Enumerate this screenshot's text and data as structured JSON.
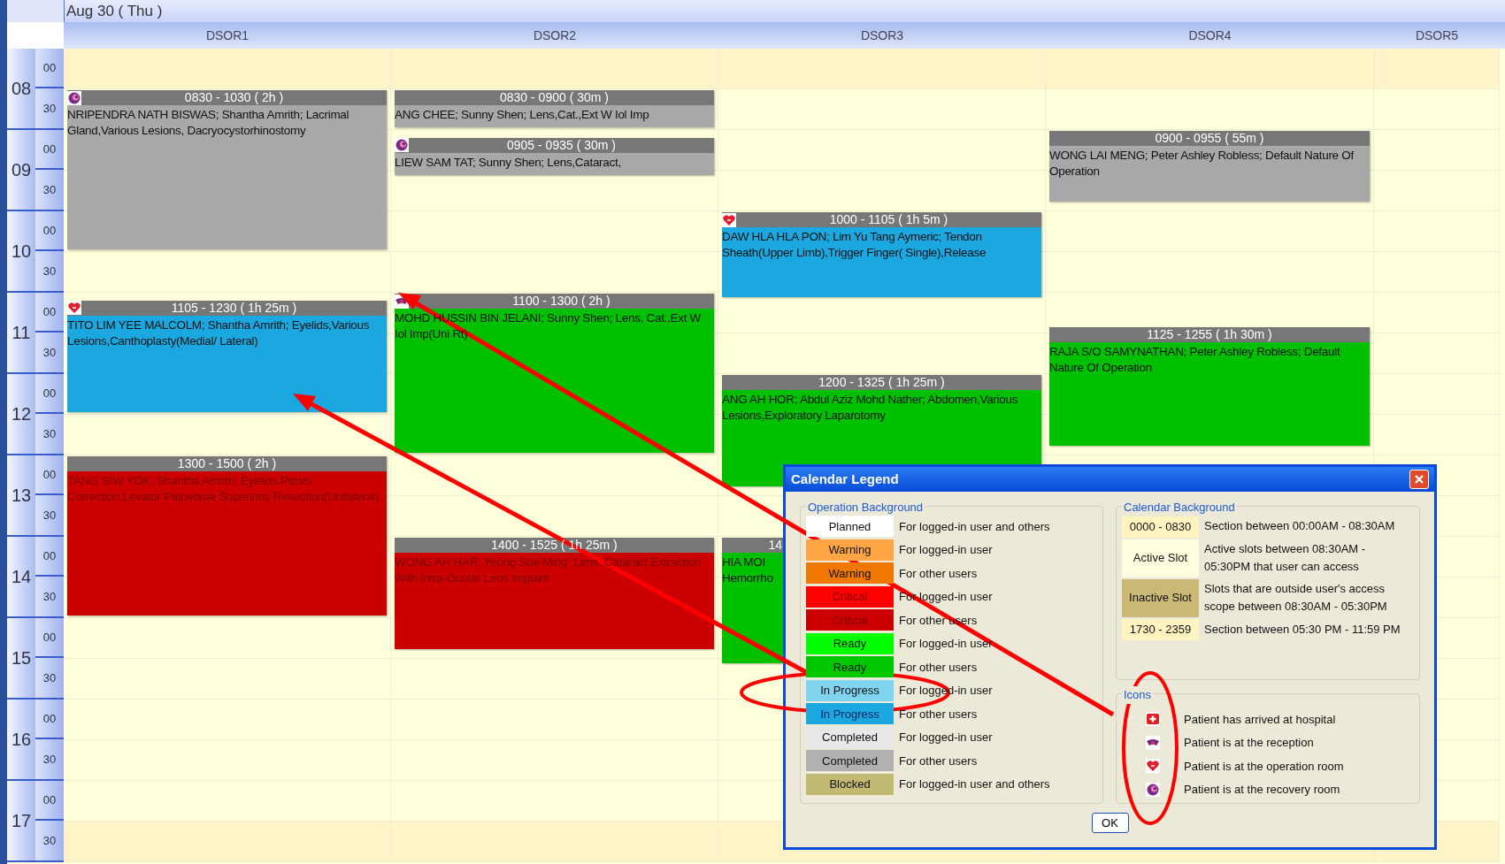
{
  "date_header": "Aug 30 ( Thu )",
  "time_axis": [
    {
      "hour": "08",
      "minutes": [
        "00",
        "30"
      ]
    },
    {
      "hour": "09",
      "minutes": [
        "00",
        "30"
      ]
    },
    {
      "hour": "10",
      "minutes": [
        "00",
        "30"
      ]
    },
    {
      "hour": "11",
      "minutes": [
        "00",
        "30"
      ]
    },
    {
      "hour": "12",
      "minutes": [
        "00",
        "30"
      ]
    },
    {
      "hour": "13",
      "minutes": [
        "00",
        "30"
      ]
    },
    {
      "hour": "14",
      "minutes": [
        "00",
        "30"
      ]
    },
    {
      "hour": "15",
      "minutes": [
        "00",
        "30"
      ]
    },
    {
      "hour": "16",
      "minutes": [
        "00",
        "30"
      ]
    },
    {
      "hour": "17",
      "minutes": [
        "00",
        "30"
      ]
    }
  ],
  "rooms": [
    {
      "name": "DSOR1",
      "events": [
        {
          "time": "0830 - 1030 ( 2h )",
          "text": "NRIPENDRA NATH BISWAS; Shantha Amrith; Lacrimal Gland,Various Lesions, Dacryocystorhinostomy",
          "kind": "completed",
          "patient_icon": {
            "kind": "recovery"
          }
        },
        {
          "time": "1105 - 1230 ( 1h 25m )",
          "text": "TITO LIM YEE MALCOLM; Shantha Amrith; Eyelids,Various Lesions,Canthoplasty(Medial/ Lateral)",
          "kind": "in_progress",
          "patient_icon": {
            "kind": "operation"
          }
        },
        {
          "time": "1300 - 1500 ( 2h )",
          "text": "TANG SIW YOK; Shantha Amrith; Eyelids,Ptosis Correction,Levator Palpebrae Superioris Resection(Unilateral)",
          "kind": "critical"
        }
      ]
    },
    {
      "name": "DSOR2",
      "events": [
        {
          "time": "0830 - 0900 ( 30m )",
          "text": "ANG CHEE; Sunny Shen; Lens,Cat.,Ext W Iol Imp",
          "kind": "completed"
        },
        {
          "time": "0905 - 0935 ( 30m )",
          "text": "LIEW SAM TAT; Sunny Shen; Lens,Cataract,",
          "kind": "completed",
          "patient_icon": {
            "kind": "recovery"
          }
        },
        {
          "time": "1100 - 1300 ( 2h )",
          "text": "MOHD HUSSIN BIN JELANI; Sunny Shen; Lens, Cat.,Ext W Iol Imp(Uni Rt)",
          "kind": "ready",
          "patient_icon": {
            "kind": "reception"
          }
        },
        {
          "time": "1400 - 1525 ( 1h 25m )",
          "text": "WONG AH HAR; Yeong Sue Ming; Lens, Cataract,Extraction With Intra-Ocular Lens Implant",
          "kind": "critical"
        }
      ]
    },
    {
      "name": "DSOR3",
      "events": [
        {
          "time": "1000 - 1105 ( 1h 5m )",
          "text": "DAW HLA HLA PON; Lim Yu Tang Aymeric; Tendon Sheath(Upper Limb),Trigger Finger( Single),Release",
          "kind": "in_progress",
          "patient_icon": {
            "kind": "operation"
          }
        },
        {
          "time": "1200 - 1325 ( 1h 25m )",
          "text": "ANG AH HOR; Abdul Aziz Mohd Nather; Abdomen,Various Lesions,Exploratory Laparotomy",
          "kind": "ready"
        },
        {
          "time": "14",
          "text": "HIA MOI Hemorrho",
          "kind": "ready"
        }
      ]
    },
    {
      "name": "DSOR4",
      "events": [
        {
          "time": "0900 - 0955 ( 55m )",
          "text": "WONG LAI MENG; Peter Ashley Robless; Default Nature Of Operation",
          "kind": "completed"
        },
        {
          "time": "1125 - 1255 ( 1h 30m )",
          "text": "RAJA S/O SAMYNATHAN; Peter Ashley Robless; Default Nature Of Operation",
          "kind": "ready"
        }
      ]
    },
    {
      "name": "DSOR5"
    }
  ],
  "legend": {
    "title": "Calendar Legend",
    "ok_button": "OK",
    "operation_background": {
      "title": "Operation Background",
      "rows": [
        {
          "label": "Planned",
          "description": "For logged-in user and others",
          "color": "#ffffff"
        },
        {
          "label": "Warning",
          "description": "For logged-in user",
          "color": "#ffa544"
        },
        {
          "label": "Warning",
          "description": "For other users",
          "color": "#f07800"
        },
        {
          "label": "Critical",
          "description": "For logged-in user",
          "color": "#ff0000"
        },
        {
          "label": "Critical",
          "description": "For other users",
          "color": "#cc0000"
        },
        {
          "label": "Ready",
          "description": "For logged-in user",
          "color": "#00ff00"
        },
        {
          "label": "Ready",
          "description": "For other users",
          "color": "#00c800"
        },
        {
          "label": "In Progress",
          "description": "For logged-in user",
          "color": "#80d4f0"
        },
        {
          "label": "In Progress",
          "description": "For other users",
          "color": "#1ba8e0"
        },
        {
          "label": "Completed",
          "description": "For logged-in user",
          "color": "#e8e8e8"
        },
        {
          "label": "Completed",
          "description": "For other users",
          "color": "#b0b0b0"
        },
        {
          "label": "Blocked",
          "description": "For logged-in user and others",
          "color": "#c2b972"
        }
      ]
    },
    "calendar_background": {
      "title": "Calendar Background",
      "rows": [
        {
          "label": "0000 - 0830",
          "description": "Section between 00:00AM - 08:30AM",
          "color": "#fff4c0"
        },
        {
          "label": "Active Slot",
          "description": "Active slots between 08:30AM - 05:30PM that user can access",
          "color": "#ffffe0"
        },
        {
          "label": "Inactive Slot",
          "description": "Slots that are outside user's access scope between 08:30AM - 05:30PM",
          "color": "#cbb978"
        },
        {
          "label": "1730 - 2359",
          "description": "Section between 05:30 PM - 11:59 PM",
          "color": "#fff4c0"
        }
      ]
    },
    "icons": {
      "title": "Icons",
      "rows": [
        {
          "kind": "arrived",
          "description": "Patient has arrived at hospital"
        },
        {
          "kind": "reception",
          "description": "Patient is at the reception"
        },
        {
          "kind": "operation",
          "description": "Patient is at the operation room"
        },
        {
          "kind": "recovery",
          "description": "Patient is at the recovery room"
        }
      ]
    }
  }
}
